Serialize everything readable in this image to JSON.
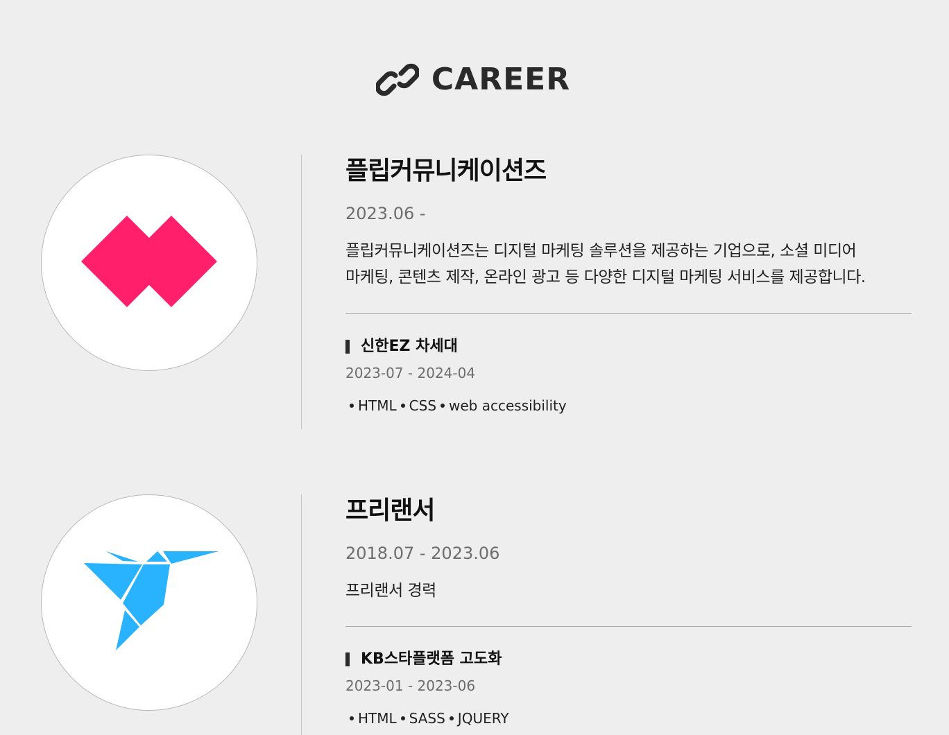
{
  "section": {
    "title": "CAREER",
    "icon": "link-icon"
  },
  "careers": [
    {
      "logo": "flip-logo-icon",
      "logo_color": "#ff1f6b",
      "company": "플립커뮤니케이션즈",
      "period": "2023.06 -",
      "description_line1": "플립커뮤니케이션즈는 디지털 마케팅 솔루션을 제공하는 기업으로, 소셜 미디어",
      "description_line2": "마케팅, 콘텐츠 제작, 온라인 광고 등 다양한 디지털 마케팅 서비스를 제공합니다.",
      "project": {
        "title": "신한EZ 차세대",
        "period": "2023-07 - 2024-04",
        "tags": [
          "HTML",
          "CSS",
          "web accessibility"
        ]
      }
    },
    {
      "logo": "bird-logo-icon",
      "logo_color": "#29b2fe",
      "company": "프리랜서",
      "period": "2018.07 - 2023.06",
      "description_line1": "프리랜서 경력",
      "project": {
        "title": "KB스타플랫폼 고도화",
        "period": "2023-01 - 2023-06",
        "tags": [
          "HTML",
          "SASS",
          "JQUERY"
        ]
      }
    }
  ]
}
